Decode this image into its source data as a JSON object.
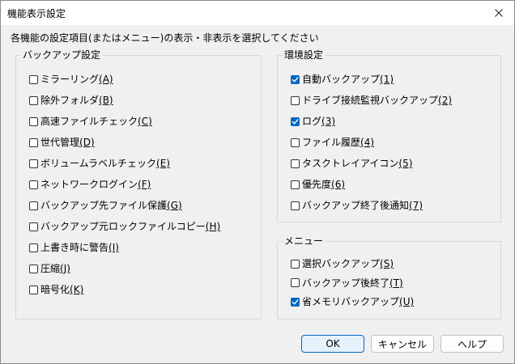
{
  "window": {
    "title": "機能表示設定",
    "close_label": "×"
  },
  "instruction": "各機能の設定項目(またはメニュー)の表示・非表示を選択してください",
  "backup_group": {
    "title": "バックアップ設定",
    "items": [
      {
        "text": "ミラーリング",
        "key": "(A)",
        "checked": false
      },
      {
        "text": "除外フォルダ",
        "key": "(B)",
        "checked": false
      },
      {
        "text": "高速ファイルチェック",
        "key": "(C)",
        "checked": false
      },
      {
        "text": "世代管理",
        "key": "(D)",
        "checked": false
      },
      {
        "text": "ボリュームラベルチェック",
        "key": "(E)",
        "checked": false
      },
      {
        "text": "ネットワークログイン",
        "key": "(F)",
        "checked": false
      },
      {
        "text": "バックアップ先ファイル保護",
        "key": "(G)",
        "checked": false
      },
      {
        "text": "バックアップ元ロックファイルコピー",
        "key": "(H)",
        "checked": false
      },
      {
        "text": "上書き時に警告",
        "key": "(I)",
        "checked": false
      },
      {
        "text": "圧縮",
        "key": "(J)",
        "checked": false
      },
      {
        "text": "暗号化",
        "key": "(K)",
        "checked": false
      }
    ]
  },
  "env_group": {
    "title": "環境設定",
    "items": [
      {
        "text": "自動バックアップ",
        "key": "(1)",
        "checked": true
      },
      {
        "text": "ドライブ接続監視バックアップ",
        "key": "(2)",
        "checked": false
      },
      {
        "text": "ログ",
        "key": "(3)",
        "checked": true
      },
      {
        "text": "ファイル履歴",
        "key": "(4)",
        "checked": false
      },
      {
        "text": "タスクトレイアイコン",
        "key": "(5)",
        "checked": false
      },
      {
        "text": "優先度",
        "key": "(6)",
        "checked": false
      },
      {
        "text": "バックアップ終了後通知",
        "key": "(7)",
        "checked": false
      }
    ]
  },
  "menu_group": {
    "title": "メニュー",
    "items": [
      {
        "text": "選択バックアップ",
        "key": "(S)",
        "checked": false
      },
      {
        "text": "バックアップ後終了",
        "key": "(T)",
        "checked": false
      },
      {
        "text": "省メモリバックアップ",
        "key": "(U)",
        "checked": true
      }
    ]
  },
  "buttons": {
    "ok": "OK",
    "cancel": "キャンセル",
    "help": "ヘルプ"
  },
  "colors": {
    "accent": "#0067c0",
    "background": "#f0f0f0",
    "titlebar": "#ffffff",
    "group_border": "#d7d7d7"
  },
  "icons": {
    "close": "close-icon",
    "check": "checkmark-icon"
  }
}
